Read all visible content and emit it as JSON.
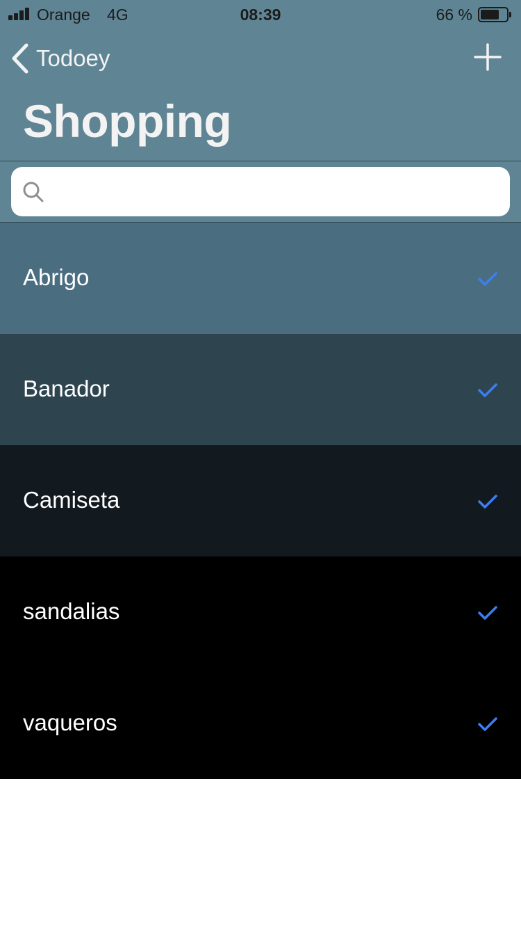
{
  "status_bar": {
    "carrier": "Orange",
    "network": "4G",
    "time": "08:39",
    "battery_percent": "66 %",
    "battery_level": 0.66
  },
  "nav": {
    "back_label": "Todoey",
    "back_icon": "chevron-left-icon",
    "add_icon": "plus-icon",
    "title": "Shopping"
  },
  "search": {
    "value": "",
    "placeholder": "",
    "icon": "magnifying-glass-icon"
  },
  "items": [
    {
      "label": "Abrigo",
      "checked": true,
      "background": "#4a6d7f"
    },
    {
      "label": "Banador",
      "checked": true,
      "background": "#2e4550"
    },
    {
      "label": "Camiseta",
      "checked": true,
      "background": "#121a20"
    },
    {
      "label": "sandalias",
      "checked": true,
      "background": "#000000"
    },
    {
      "label": "vaqueros",
      "checked": true,
      "background": "#000000"
    }
  ],
  "colors": {
    "nav_background": "#5f8494",
    "checkmark": "#3d7ef5",
    "title_text": "#f3f3f3"
  }
}
